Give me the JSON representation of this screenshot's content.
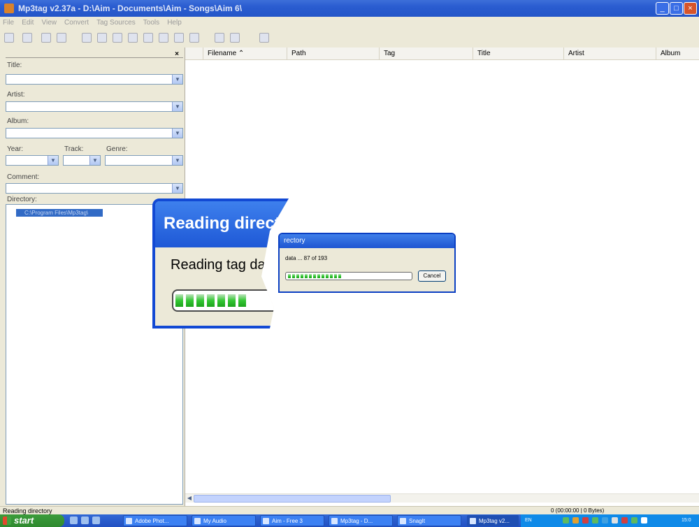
{
  "window": {
    "title": "Mp3tag v2.37a - D:\\Aim - Documents\\Aim - Songs\\Aim 6\\"
  },
  "menu": [
    "File",
    "Edit",
    "View",
    "Convert",
    "Tag Sources",
    "Tools",
    "Help"
  ],
  "toolbar_icons": [
    "save-icon",
    "remove-tag-icon",
    "undo-icon",
    "change-directory-icon",
    "add-directory-icon",
    "favorite-icon",
    "options-icon",
    "tag-file-icon",
    "file-tag-icon",
    "text-file-icon",
    "convert-icon",
    "freedb-icon",
    "export-icon",
    "playlist-icon",
    "help-icon"
  ],
  "sidebar": {
    "close": "×",
    "title_label": "Title:",
    "artist_label": "Artist:",
    "album_label": "Album:",
    "year_label": "Year:",
    "track_label": "Track:",
    "genre_label": "Genre:",
    "comment_label": "Comment:",
    "directory_label": "Directory:",
    "directory_value": "C:\\Program Files\\Mp3tag\\"
  },
  "columns": [
    "Filename",
    "Path",
    "Tag",
    "Title",
    "Artist",
    "Album"
  ],
  "sort_indicator": "⌃",
  "dialog": {
    "title": "Reading directory",
    "title_partial": "rectory",
    "message": "Reading tag data ...",
    "message_partial": "data ... 87 of 193",
    "current": 87,
    "total": 193,
    "cancel_label": "Cancel"
  },
  "statusbar": {
    "left": "Reading directory",
    "right": "0 (00:00:00 | 0 Bytes)"
  },
  "taskbar": {
    "start_label": "start",
    "tasks": [
      "Adobe Phot...",
      "My Audio",
      "Aim - Free 3",
      "Mp3tag - D...",
      "SnagIt",
      "Mp3tag v2..."
    ],
    "language": "EN",
    "clock": "15:0"
  },
  "colors": {
    "title_bar": "#2a5cd0",
    "taskbar": "#245edb",
    "start": "#3b9c3b",
    "progress": "#33c733",
    "selection": "#316ac5"
  }
}
